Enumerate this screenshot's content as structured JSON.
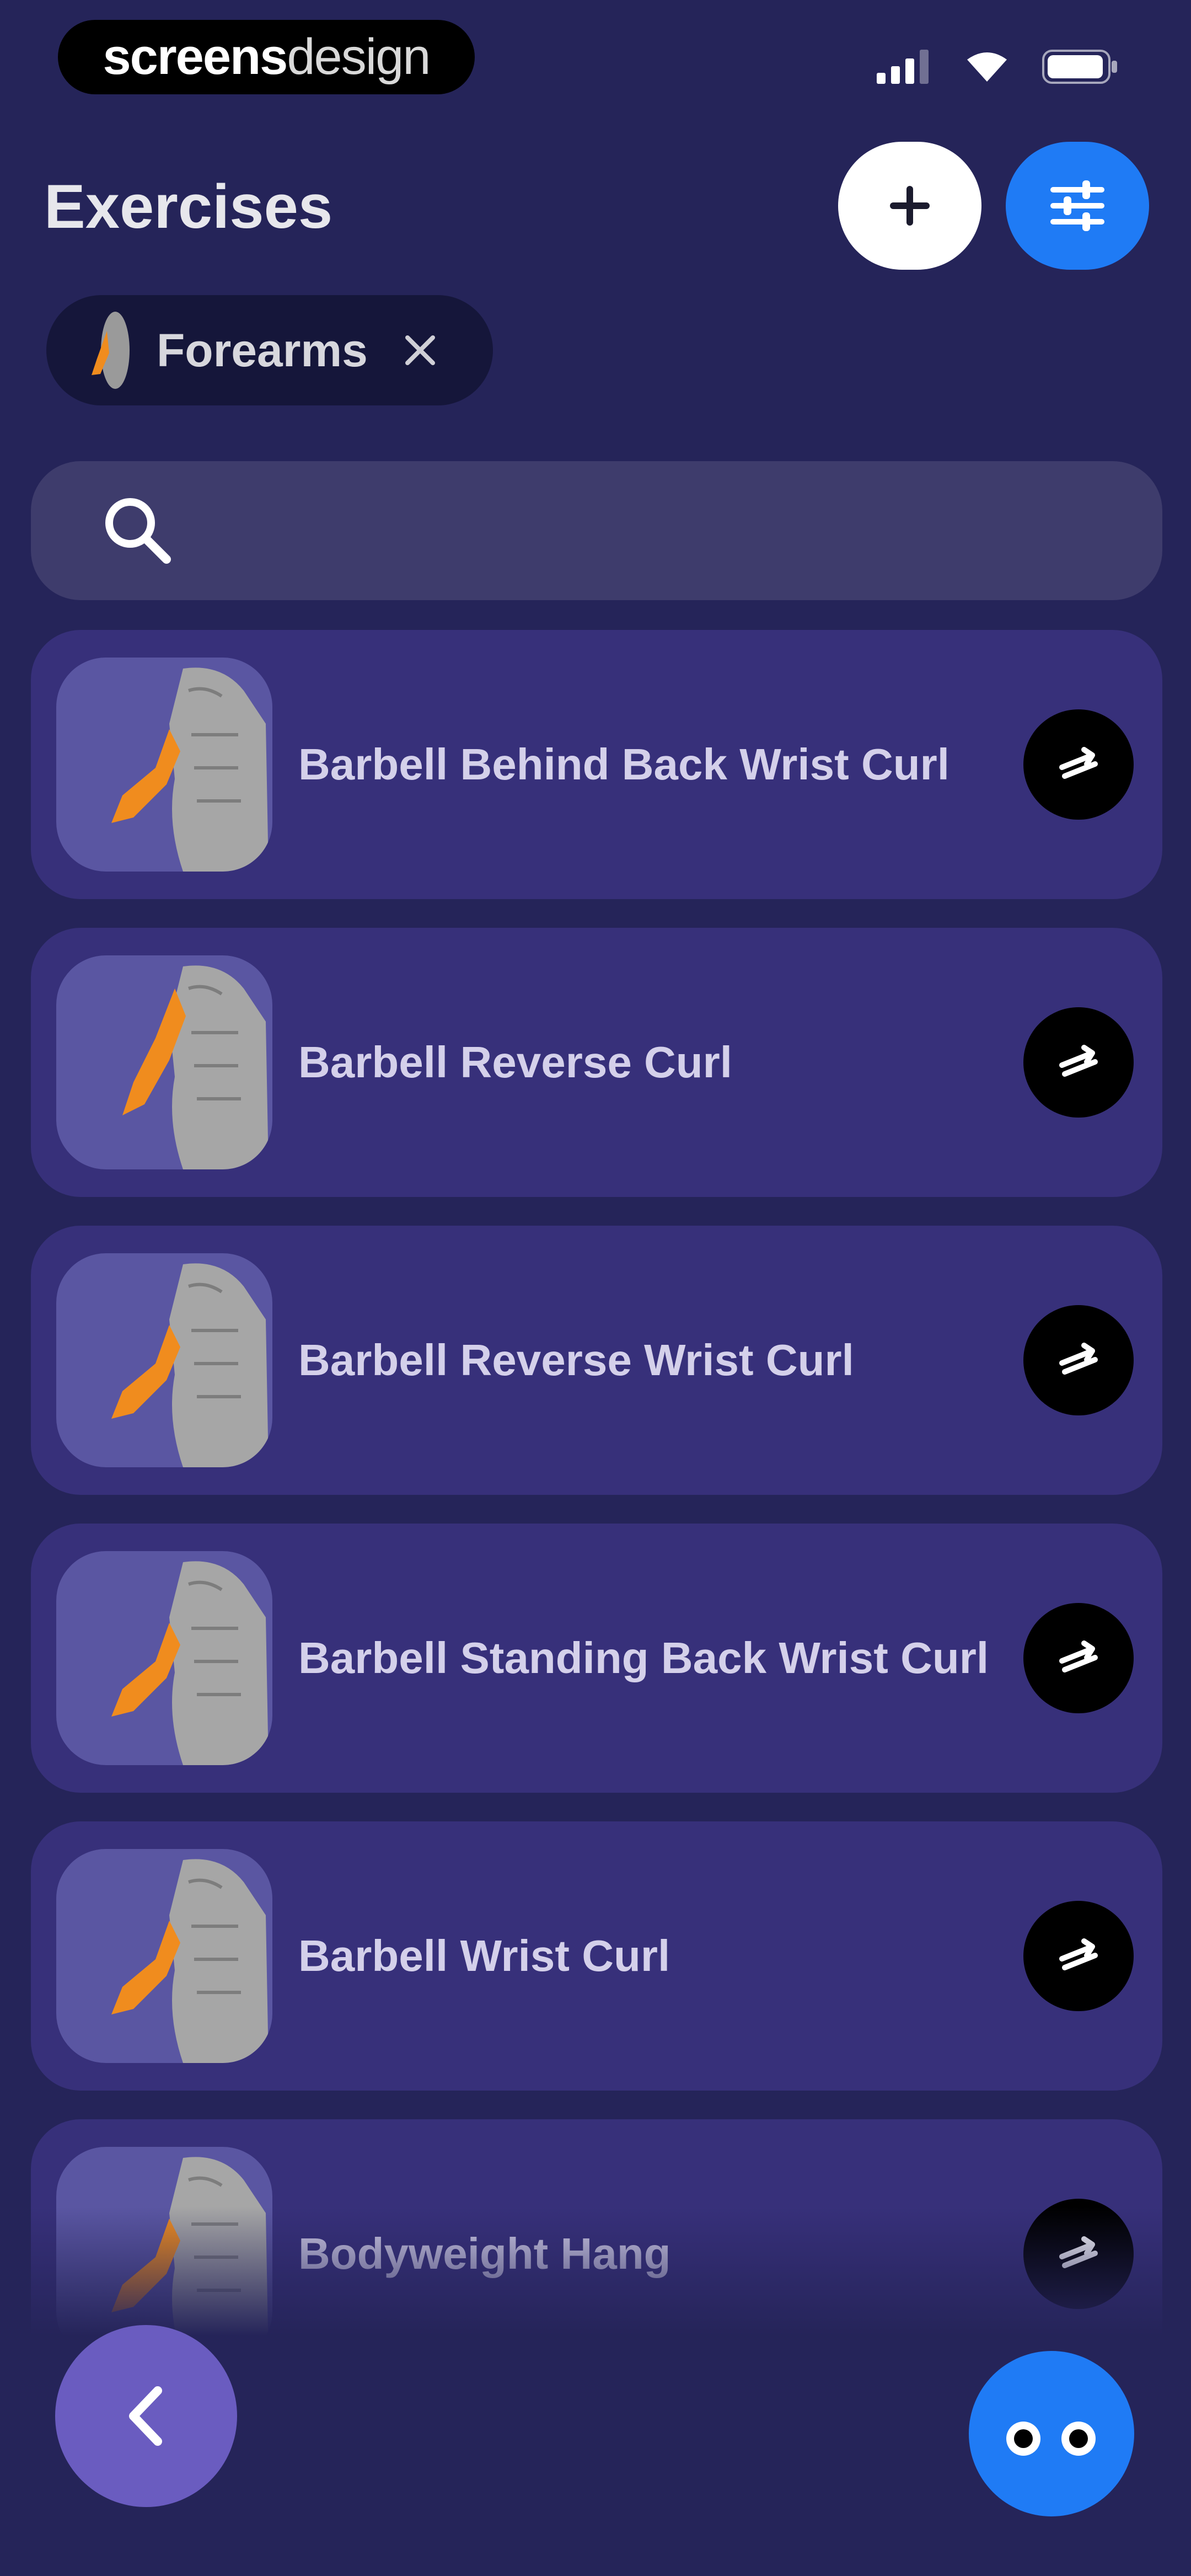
{
  "status_bar": {
    "brand_bold": "screens",
    "brand_light": "design",
    "icons": [
      "signal-icon",
      "wifi-icon",
      "battery-icon"
    ]
  },
  "header": {
    "title": "Exercises",
    "add_icon": "plus-icon",
    "filter_icon": "sliders-icon"
  },
  "filter_chip": {
    "label": "Forearms",
    "remove_icon": "close-icon"
  },
  "search": {
    "icon": "search-icon",
    "value": "",
    "placeholder": ""
  },
  "exercises": [
    {
      "name": "Barbell Behind Back Wrist Curl"
    },
    {
      "name": "Barbell Reverse Curl"
    },
    {
      "name": "Barbell Reverse Wrist Curl"
    },
    {
      "name": "Barbell Standing Back Wrist Curl"
    },
    {
      "name": "Barbell Wrist Curl"
    },
    {
      "name": "Bodyweight Hang"
    }
  ],
  "floating": {
    "back_icon": "chevron-left-icon",
    "assistant_icon": "assistant-eyes-icon"
  },
  "colors": {
    "background": "#252459",
    "card": "#37307a",
    "thumb": "#5a56a2",
    "accent_blue": "#1f7bf5",
    "back_purple": "#6a5cc0",
    "muscle_highlight": "#f08c1e"
  }
}
